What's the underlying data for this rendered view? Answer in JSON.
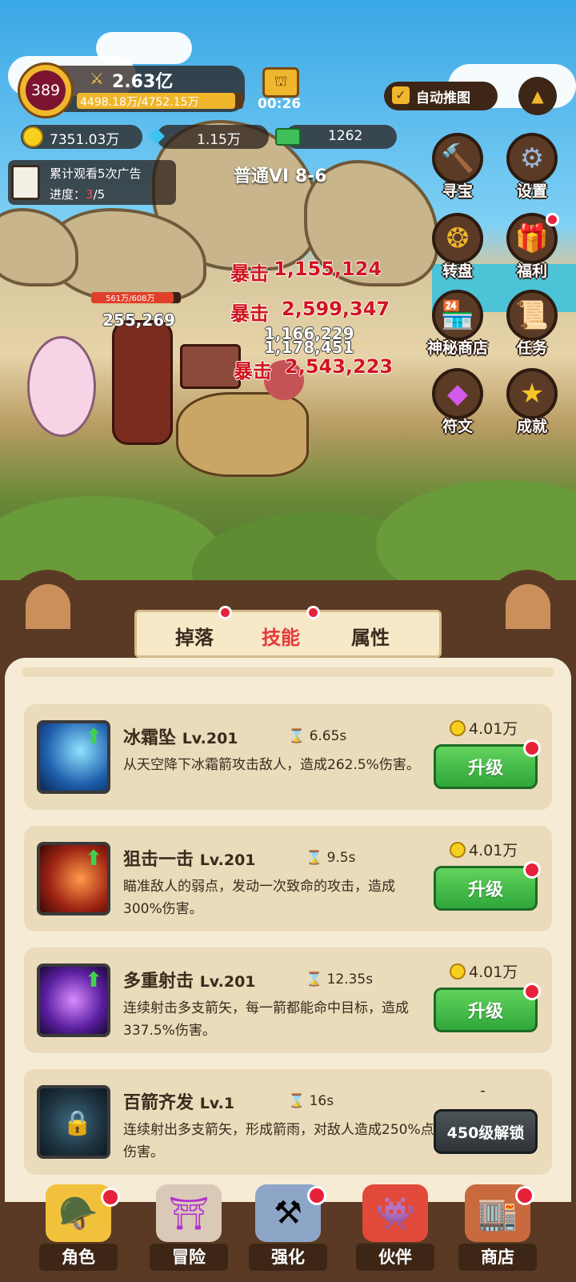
{
  "hud": {
    "level": "389",
    "power": "2.63亿",
    "exp": "4498.18万/4752.15万",
    "timer": "00:26",
    "auto_push": "自动推图",
    "gold": "7351.03万",
    "diamond": "1.15万",
    "cash": "1262"
  },
  "ad_task": {
    "text": "累计观看5次广告",
    "progress_label": "进度：",
    "progress_current": "3",
    "progress_total": "/5"
  },
  "stage": "普通VI 8-6",
  "side_menu": [
    {
      "label": "寻宝",
      "icon": "hammer-icon"
    },
    {
      "label": "设置",
      "icon": "gear-icon"
    },
    {
      "label": "转盘",
      "icon": "wheel-icon"
    },
    {
      "label": "福利",
      "icon": "gift-icon"
    },
    {
      "label": "神秘商店",
      "icon": "shop-icon"
    },
    {
      "label": "任务",
      "icon": "scroll-icon"
    },
    {
      "label": "符文",
      "icon": "gem-icon"
    },
    {
      "label": "成就",
      "icon": "star-icon"
    }
  ],
  "battle": {
    "enemy_hp": "561万/608万",
    "player_dmg": "255,269",
    "crit_label": "暴击",
    "crit_values": [
      "1,155,124",
      "2,599,347",
      "2,543,223"
    ],
    "plain_values": [
      "1,155,124",
      "1,166,229",
      "1,178,451"
    ]
  },
  "tabs": [
    "掉落",
    "技能",
    "属性"
  ],
  "skills": [
    {
      "name": "冰霜坠",
      "level": "Lv.201",
      "cd": "6.65s",
      "desc": "从天空降下冰霜箭攻击敌人，造成262.5%伤害。",
      "cost": "4.01万",
      "button": "升级",
      "locked": false,
      "color": "#1f5fae"
    },
    {
      "name": "狙击一击",
      "level": "Lv.201",
      "cd": "9.5s",
      "desc": "瞄准敌人的弱点，发动一次致命的攻击，造成300%伤害。",
      "cost": "4.01万",
      "button": "升级",
      "locked": false,
      "color": "#9c2212"
    },
    {
      "name": "多重射击",
      "level": "Lv.201",
      "cd": "12.35s",
      "desc": "连续射击多支箭矢，每一箭都能命中目标，造成337.5%伤害。",
      "cost": "4.01万",
      "button": "升级",
      "locked": false,
      "color": "#5a1fa0"
    },
    {
      "name": "百箭齐发",
      "level": "Lv.1",
      "cd": "16s",
      "desc": "连续射出多支箭矢，形成箭雨，对敌人造成250%点伤害。",
      "cost": "-",
      "button": "450级解锁",
      "locked": true,
      "color": "#1e3340"
    }
  ],
  "nav": [
    "角色",
    "冒险",
    "强化",
    "伙伴",
    "商店"
  ]
}
